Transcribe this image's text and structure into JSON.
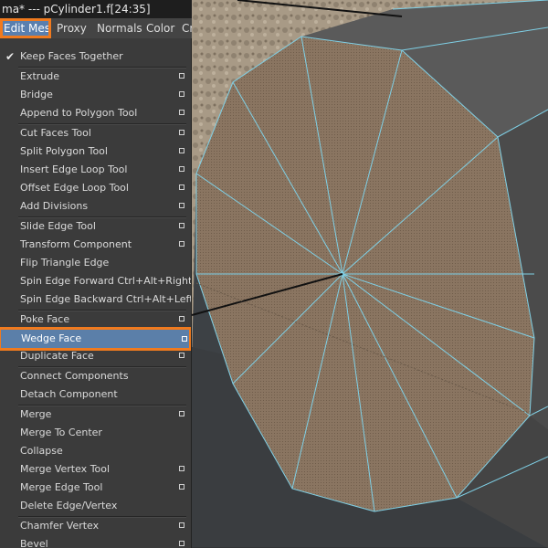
{
  "title_bar": {
    "text": "ma*  ---  pCylinder1.f[24:35]"
  },
  "menu_bar": {
    "items": [
      {
        "label": "Edit Mesh"
      },
      {
        "label": "Proxy"
      },
      {
        "label": "Normals"
      },
      {
        "label": "Color"
      },
      {
        "label": "Cr"
      }
    ]
  },
  "menu": {
    "items": [
      {
        "label": "Keep Faces Together",
        "checked": true
      },
      {
        "label": "Extrude"
      },
      {
        "label": "Bridge"
      },
      {
        "label": "Append to Polygon Tool"
      },
      {
        "label": "Cut Faces Tool"
      },
      {
        "label": "Split Polygon Tool"
      },
      {
        "label": "Insert Edge Loop Tool"
      },
      {
        "label": "Offset Edge Loop Tool"
      },
      {
        "label": "Add Divisions"
      },
      {
        "label": "Slide Edge Tool"
      },
      {
        "label": "Transform Component"
      },
      {
        "label": "Flip Triangle Edge"
      },
      {
        "label": "Spin Edge Forward  Ctrl+Alt+Right"
      },
      {
        "label": "Spin Edge Backward  Ctrl+Alt+Left"
      },
      {
        "label": "Poke Face"
      },
      {
        "label": "Wedge Face",
        "highlighted": true
      },
      {
        "label": "Duplicate Face"
      },
      {
        "label": "Connect Components"
      },
      {
        "label": "Detach Component"
      },
      {
        "label": "Merge"
      },
      {
        "label": "Merge To Center"
      },
      {
        "label": "Collapse"
      },
      {
        "label": "Merge Vertex Tool"
      },
      {
        "label": "Merge Edge Tool"
      },
      {
        "label": "Delete Edge/Vertex"
      },
      {
        "label": "Chamfer Vertex"
      },
      {
        "label": "Bevel"
      }
    ]
  },
  "colors": {
    "highlight": "#5b7fa9",
    "annotation_outline": "#f07a1e",
    "face_fill": "#8c7762",
    "wireframe": "#7fd0e6"
  }
}
